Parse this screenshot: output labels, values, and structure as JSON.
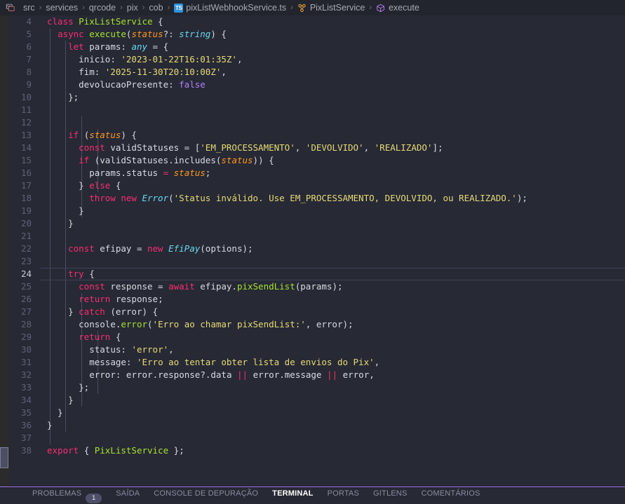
{
  "breadcrumb": {
    "leading_icon": "split-editor-icon",
    "separator": "›",
    "items": [
      {
        "label": "src",
        "icon": null
      },
      {
        "label": "services",
        "icon": null
      },
      {
        "label": "qrcode",
        "icon": null
      },
      {
        "label": "pix",
        "icon": null
      },
      {
        "label": "cob",
        "icon": null
      },
      {
        "label": "pixListWebhookService.ts",
        "icon": "typescript-file-icon",
        "icon_text": "TS"
      },
      {
        "label": "PixListService",
        "icon": "class-symbol-icon"
      },
      {
        "label": "execute",
        "icon": "method-symbol-icon"
      }
    ]
  },
  "editor": {
    "active_line": 24,
    "first_line": 4,
    "lines": [
      {
        "n": 4,
        "tokens": [
          {
            "t": "class ",
            "c": "kw"
          },
          {
            "t": "PixListService",
            "c": "cls"
          },
          {
            "t": " {",
            "c": "pun"
          }
        ]
      },
      {
        "n": 5,
        "tokens": [
          {
            "t": "  ",
            "c": "pun"
          },
          {
            "t": "async ",
            "c": "kw"
          },
          {
            "t": "execute",
            "c": "fn"
          },
          {
            "t": "(",
            "c": "pun"
          },
          {
            "t": "status",
            "c": "par"
          },
          {
            "t": "?: ",
            "c": "pun"
          },
          {
            "t": "string",
            "c": "typ"
          },
          {
            "t": ") {",
            "c": "pun"
          }
        ]
      },
      {
        "n": 6,
        "tokens": [
          {
            "t": "    ",
            "c": "pun"
          },
          {
            "t": "let ",
            "c": "kw"
          },
          {
            "t": "params",
            "c": "prop"
          },
          {
            "t": ": ",
            "c": "pun"
          },
          {
            "t": "any",
            "c": "typ"
          },
          {
            "t": " = {",
            "c": "pun"
          }
        ]
      },
      {
        "n": 7,
        "tokens": [
          {
            "t": "      ",
            "c": "pun"
          },
          {
            "t": "inicio",
            "c": "prop"
          },
          {
            "t": ": ",
            "c": "pun"
          },
          {
            "t": "'2023-01-22T16:01:35Z'",
            "c": "str"
          },
          {
            "t": ",",
            "c": "pun"
          }
        ]
      },
      {
        "n": 8,
        "tokens": [
          {
            "t": "      ",
            "c": "pun"
          },
          {
            "t": "fim",
            "c": "prop"
          },
          {
            "t": ": ",
            "c": "pun"
          },
          {
            "t": "'2025-11-30T20:10:00Z'",
            "c": "str"
          },
          {
            "t": ",",
            "c": "pun"
          }
        ]
      },
      {
        "n": 9,
        "tokens": [
          {
            "t": "      ",
            "c": "pun"
          },
          {
            "t": "devolucaoPresente",
            "c": "prop"
          },
          {
            "t": ": ",
            "c": "pun"
          },
          {
            "t": "false",
            "c": "num"
          }
        ]
      },
      {
        "n": 10,
        "tokens": [
          {
            "t": "    };",
            "c": "pun"
          }
        ]
      },
      {
        "n": 11,
        "tokens": []
      },
      {
        "n": 12,
        "tokens": []
      },
      {
        "n": 13,
        "tokens": [
          {
            "t": "    ",
            "c": "pun"
          },
          {
            "t": "if ",
            "c": "kw"
          },
          {
            "t": "(",
            "c": "pun"
          },
          {
            "t": "status",
            "c": "par"
          },
          {
            "t": ") {",
            "c": "pun"
          }
        ]
      },
      {
        "n": 14,
        "tokens": [
          {
            "t": "      ",
            "c": "pun"
          },
          {
            "t": "const ",
            "c": "kw"
          },
          {
            "t": "validStatuses",
            "c": "prop"
          },
          {
            "t": " = [",
            "c": "pun"
          },
          {
            "t": "'EM_PROCESSAMENTO'",
            "c": "str"
          },
          {
            "t": ", ",
            "c": "pun"
          },
          {
            "t": "'DEVOLVIDO'",
            "c": "str"
          },
          {
            "t": ", ",
            "c": "pun"
          },
          {
            "t": "'REALIZADO'",
            "c": "str"
          },
          {
            "t": "];",
            "c": "pun"
          }
        ]
      },
      {
        "n": 15,
        "tokens": [
          {
            "t": "      ",
            "c": "pun"
          },
          {
            "t": "if ",
            "c": "kw"
          },
          {
            "t": "(",
            "c": "pun"
          },
          {
            "t": "validStatuses",
            "c": "prop"
          },
          {
            "t": ".",
            "c": "pun"
          },
          {
            "t": "includes",
            "c": "prop"
          },
          {
            "t": "(",
            "c": "pun"
          },
          {
            "t": "status",
            "c": "par"
          },
          {
            "t": ")) {",
            "c": "pun"
          }
        ]
      },
      {
        "n": 16,
        "tokens": [
          {
            "t": "        ",
            "c": "pun"
          },
          {
            "t": "params",
            "c": "prop"
          },
          {
            "t": ".",
            "c": "pun"
          },
          {
            "t": "status",
            "c": "prop"
          },
          {
            "t": " = ",
            "c": "op"
          },
          {
            "t": "status",
            "c": "par"
          },
          {
            "t": ";",
            "c": "pun"
          }
        ]
      },
      {
        "n": 17,
        "tokens": [
          {
            "t": "      } ",
            "c": "pun"
          },
          {
            "t": "else",
            "c": "kw"
          },
          {
            "t": " {",
            "c": "pun"
          }
        ]
      },
      {
        "n": 18,
        "tokens": [
          {
            "t": "        ",
            "c": "pun"
          },
          {
            "t": "throw ",
            "c": "kw"
          },
          {
            "t": "new ",
            "c": "kw"
          },
          {
            "t": "Error",
            "c": "err"
          },
          {
            "t": "(",
            "c": "pun"
          },
          {
            "t": "'Status inválido. Use EM_PROCESSAMENTO, DEVOLVIDO, ou REALIZADO.'",
            "c": "str"
          },
          {
            "t": ");",
            "c": "pun"
          }
        ]
      },
      {
        "n": 19,
        "tokens": [
          {
            "t": "      }",
            "c": "pun"
          }
        ]
      },
      {
        "n": 20,
        "tokens": [
          {
            "t": "    }",
            "c": "pun"
          }
        ]
      },
      {
        "n": 21,
        "tokens": []
      },
      {
        "n": 22,
        "tokens": [
          {
            "t": "    ",
            "c": "pun"
          },
          {
            "t": "const ",
            "c": "kw"
          },
          {
            "t": "efipay",
            "c": "prop"
          },
          {
            "t": " = ",
            "c": "pun"
          },
          {
            "t": "new ",
            "c": "kw"
          },
          {
            "t": "EfiPay",
            "c": "err"
          },
          {
            "t": "(",
            "c": "pun"
          },
          {
            "t": "options",
            "c": "prop"
          },
          {
            "t": ");",
            "c": "pun"
          }
        ]
      },
      {
        "n": 23,
        "tokens": []
      },
      {
        "n": 24,
        "tokens": [
          {
            "t": "    ",
            "c": "pun"
          },
          {
            "t": "try",
            "c": "kw"
          },
          {
            "t": " {",
            "c": "pun"
          }
        ]
      },
      {
        "n": 25,
        "tokens": [
          {
            "t": "      ",
            "c": "pun"
          },
          {
            "t": "const ",
            "c": "kw"
          },
          {
            "t": "response",
            "c": "prop"
          },
          {
            "t": " = ",
            "c": "pun"
          },
          {
            "t": "await ",
            "c": "kw"
          },
          {
            "t": "efipay",
            "c": "prop"
          },
          {
            "t": ".",
            "c": "pun"
          },
          {
            "t": "pixSendList",
            "c": "fn"
          },
          {
            "t": "(",
            "c": "pun"
          },
          {
            "t": "params",
            "c": "prop"
          },
          {
            "t": ");",
            "c": "pun"
          }
        ]
      },
      {
        "n": 26,
        "tokens": [
          {
            "t": "      ",
            "c": "pun"
          },
          {
            "t": "return ",
            "c": "kw"
          },
          {
            "t": "response",
            "c": "prop"
          },
          {
            "t": ";",
            "c": "pun"
          }
        ]
      },
      {
        "n": 27,
        "tokens": [
          {
            "t": "    } ",
            "c": "pun"
          },
          {
            "t": "catch",
            "c": "kw"
          },
          {
            "t": " (",
            "c": "pun"
          },
          {
            "t": "error",
            "c": "prop"
          },
          {
            "t": ") {",
            "c": "pun"
          }
        ]
      },
      {
        "n": 28,
        "tokens": [
          {
            "t": "      ",
            "c": "pun"
          },
          {
            "t": "console",
            "c": "prop"
          },
          {
            "t": ".",
            "c": "pun"
          },
          {
            "t": "error",
            "c": "fn"
          },
          {
            "t": "(",
            "c": "pun"
          },
          {
            "t": "'Erro ao chamar pixSendList:'",
            "c": "str"
          },
          {
            "t": ", ",
            "c": "pun"
          },
          {
            "t": "error",
            "c": "prop"
          },
          {
            "t": ");",
            "c": "pun"
          }
        ]
      },
      {
        "n": 29,
        "tokens": [
          {
            "t": "      ",
            "c": "pun"
          },
          {
            "t": "return",
            "c": "kw"
          },
          {
            "t": " {",
            "c": "pun"
          }
        ]
      },
      {
        "n": 30,
        "tokens": [
          {
            "t": "        ",
            "c": "pun"
          },
          {
            "t": "status",
            "c": "prop"
          },
          {
            "t": ": ",
            "c": "pun"
          },
          {
            "t": "'error'",
            "c": "str"
          },
          {
            "t": ",",
            "c": "pun"
          }
        ]
      },
      {
        "n": 31,
        "tokens": [
          {
            "t": "        ",
            "c": "pun"
          },
          {
            "t": "message",
            "c": "prop"
          },
          {
            "t": ": ",
            "c": "pun"
          },
          {
            "t": "'Erro ao tentar obter lista de envios do Pix'",
            "c": "str"
          },
          {
            "t": ",",
            "c": "pun"
          }
        ]
      },
      {
        "n": 32,
        "tokens": [
          {
            "t": "        ",
            "c": "pun"
          },
          {
            "t": "error",
            "c": "prop"
          },
          {
            "t": ": ",
            "c": "pun"
          },
          {
            "t": "error",
            "c": "prop"
          },
          {
            "t": ".",
            "c": "pun"
          },
          {
            "t": "response",
            "c": "prop"
          },
          {
            "t": "?.",
            "c": "pun"
          },
          {
            "t": "data",
            "c": "prop"
          },
          {
            "t": " ",
            "c": "pun"
          },
          {
            "t": "||",
            "c": "op"
          },
          {
            "t": " ",
            "c": "pun"
          },
          {
            "t": "error",
            "c": "prop"
          },
          {
            "t": ".",
            "c": "pun"
          },
          {
            "t": "message",
            "c": "prop"
          },
          {
            "t": " ",
            "c": "pun"
          },
          {
            "t": "||",
            "c": "op"
          },
          {
            "t": " ",
            "c": "pun"
          },
          {
            "t": "error",
            "c": "prop"
          },
          {
            "t": ",",
            "c": "pun"
          }
        ]
      },
      {
        "n": 33,
        "tokens": [
          {
            "t": "      };",
            "c": "pun"
          }
        ]
      },
      {
        "n": 34,
        "tokens": [
          {
            "t": "    }",
            "c": "pun"
          }
        ]
      },
      {
        "n": 35,
        "tokens": [
          {
            "t": "  }",
            "c": "pun"
          }
        ]
      },
      {
        "n": 36,
        "tokens": [
          {
            "t": "}",
            "c": "pun"
          }
        ]
      },
      {
        "n": 37,
        "tokens": []
      },
      {
        "n": 38,
        "tokens": [
          {
            "t": "",
            "c": "pun"
          },
          {
            "t": "export ",
            "c": "kw"
          },
          {
            "t": "{ ",
            "c": "pun"
          },
          {
            "t": "PixListService",
            "c": "cls"
          },
          {
            "t": " };",
            "c": "pun"
          }
        ]
      }
    ]
  },
  "panel": {
    "tabs": [
      {
        "label": "PROBLEMAS",
        "badge": "1",
        "active": false
      },
      {
        "label": "SAÍDA",
        "badge": null,
        "active": false
      },
      {
        "label": "CONSOLE DE DEPURAÇÃO",
        "badge": null,
        "active": false
      },
      {
        "label": "TERMINAL",
        "badge": null,
        "active": true
      },
      {
        "label": "PORTAS",
        "badge": null,
        "active": false
      },
      {
        "label": "GITLENS",
        "badge": null,
        "active": false
      },
      {
        "label": "COMENTÁRIOS",
        "badge": null,
        "active": false
      }
    ]
  },
  "colors": {
    "editor_background": "#272935",
    "activity_bar_background": "#2b2b2b",
    "panel_border": "#a06ee8",
    "accent_keyword": "#f92d72",
    "accent_string": "#e6db74",
    "accent_function": "#a6e22e",
    "accent_number": "#ae81ff",
    "accent_param": "#fd971f",
    "badge_background": "#4d5066"
  }
}
